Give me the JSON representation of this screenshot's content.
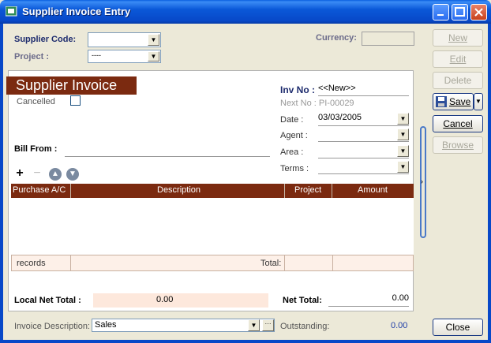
{
  "window": {
    "title": "Supplier Invoice Entry"
  },
  "header": {
    "supplier_code_label": "Supplier Code:",
    "supplier_code_value": "",
    "currency_label": "Currency:",
    "currency_value": "",
    "project_label": "Project :",
    "project_value": "----"
  },
  "doc": {
    "banner": "Supplier Invoice",
    "cancelled_label": "Cancelled",
    "inv_no_label": "Inv No :",
    "inv_no_value": "<<New>>",
    "next_no": "Next No : PI-00029",
    "date_label": "Date :",
    "date_value": "03/03/2005",
    "agent_label": "Agent :",
    "area_label": "Area :",
    "terms_label": "Terms :",
    "bill_from_label": "Bill From :"
  },
  "table": {
    "columns": [
      "Purchase A/C",
      "Description",
      "Project",
      "Amount"
    ],
    "footer_records": "records",
    "footer_total": "Total:"
  },
  "totals": {
    "local_net_label": "Local Net Total :",
    "local_net_value": "0.00",
    "net_total_label": "Net Total:",
    "net_total_value": "0.00",
    "invoice_desc_label": "Invoice Description:",
    "invoice_desc_value": "Sales",
    "outstanding_label": "Outstanding:",
    "outstanding_value": "0.00"
  },
  "sidebar": {
    "new": "New",
    "edit": "Edit",
    "delete": "Delete",
    "save": "Save",
    "cancel": "Cancel",
    "browse": "Browse",
    "close": "Close"
  },
  "colors": {
    "accent": "#7b2a10",
    "titlebar": "#0848c8",
    "outstanding": "#1f3ea8"
  }
}
